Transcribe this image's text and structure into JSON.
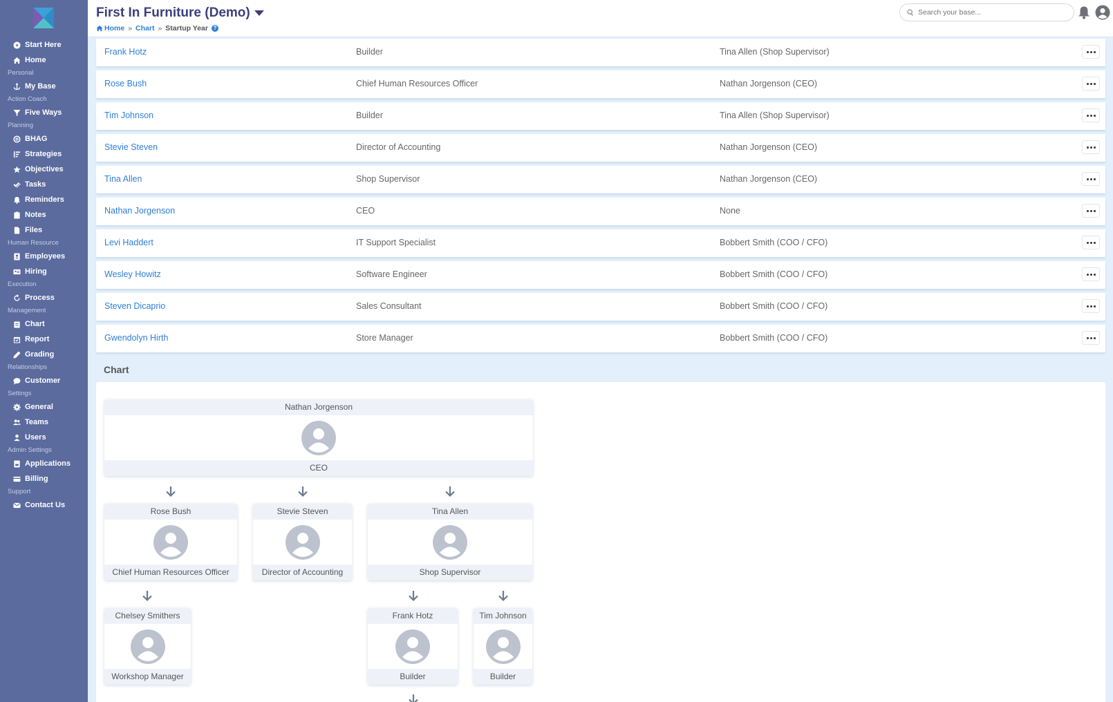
{
  "header": {
    "title": "First In Furniture (Demo)",
    "breadcrumb": {
      "home": "Home",
      "chart": "Chart",
      "current": "Startup Year",
      "sep": "»"
    },
    "search_placeholder": "Search your base..."
  },
  "sidebar": {
    "start_here": "Start Here",
    "home": "Home",
    "personal": "Personal",
    "my_base": "My Base",
    "action_coach": "Action Coach",
    "five_ways": "Five Ways",
    "planning": "Planning",
    "bhag": "BHAG",
    "strategies": "Strategies",
    "objectives": "Objectives",
    "tasks": "Tasks",
    "reminders": "Reminders",
    "notes": "Notes",
    "files": "Files",
    "human_resource": "Human Resource",
    "employees": "Employees",
    "hiring": "Hiring",
    "execution": "Execution",
    "process": "Process",
    "management": "Management",
    "chart": "Chart",
    "report": "Report",
    "grading": "Grading",
    "relationships": "Relationships",
    "customer": "Customer",
    "settings": "Settings",
    "general": "General",
    "teams": "Teams",
    "users": "Users",
    "admin_settings": "Admin Settings",
    "applications": "Applications",
    "billing": "Billing",
    "support": "Support",
    "contact_us": "Contact Us"
  },
  "employees": [
    {
      "name": "Frank Hotz",
      "position": "Builder",
      "supervisor": "Tina Allen (Shop Supervisor)"
    },
    {
      "name": "Rose Bush",
      "position": "Chief Human Resources Officer",
      "supervisor": "Nathan Jorgenson (CEO)"
    },
    {
      "name": "Tim Johnson",
      "position": "Builder",
      "supervisor": "Tina Allen (Shop Supervisor)"
    },
    {
      "name": "Stevie Steven",
      "position": "Director of Accounting",
      "supervisor": "Nathan Jorgenson (CEO)"
    },
    {
      "name": "Tina Allen",
      "position": "Shop Supervisor",
      "supervisor": "Nathan Jorgenson (CEO)"
    },
    {
      "name": "Nathan Jorgenson",
      "position": "CEO",
      "supervisor": "None"
    },
    {
      "name": "Levi Haddert",
      "position": "IT Support Specialist",
      "supervisor": "Bobbert Smith (COO / CFO)"
    },
    {
      "name": "Wesley Howitz",
      "position": "Software Engineer",
      "supervisor": "Bobbert Smith (COO / CFO)"
    },
    {
      "name": "Steven Dicaprio",
      "position": "Sales Consultant",
      "supervisor": "Bobbert Smith (COO / CFO)"
    },
    {
      "name": "Gwendolyn Hirth",
      "position": "Store Manager",
      "supervisor": "Bobbert Smith (COO / CFO)"
    }
  ],
  "chart": {
    "title": "Chart",
    "nodes": {
      "nathan": {
        "name": "Nathan Jorgenson",
        "position": "CEO"
      },
      "rose": {
        "name": "Rose Bush",
        "position": "Chief Human Resources Officer"
      },
      "stevie": {
        "name": "Stevie Steven",
        "position": "Director of Accounting"
      },
      "tina": {
        "name": "Tina Allen",
        "position": "Shop Supervisor"
      },
      "chelsey": {
        "name": "Chelsey Smithers",
        "position": "Workshop Manager"
      },
      "frank": {
        "name": "Frank Hotz",
        "position": "Builder"
      },
      "tim": {
        "name": "Tim Johnson",
        "position": "Builder"
      }
    }
  },
  "colors": {
    "sidebar": "#5b6b9e",
    "link": "#2f7fd6",
    "page_bg": "#e3f0fb",
    "title": "#3c3f7a"
  }
}
